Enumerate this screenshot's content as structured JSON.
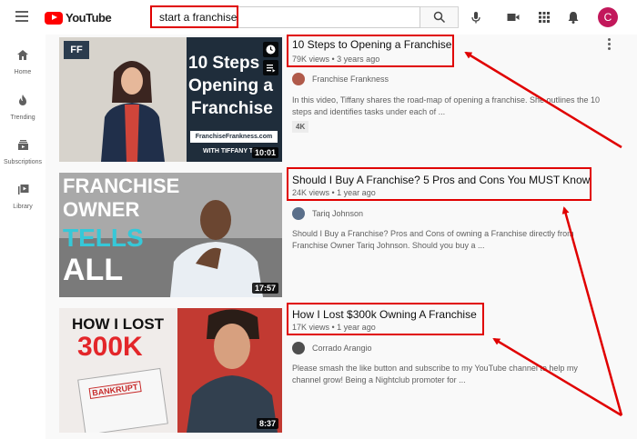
{
  "app": {
    "logo_text": "YouTube",
    "avatar_letter": "C"
  },
  "search": {
    "query": "start a franchise"
  },
  "sidebar": {
    "items": [
      {
        "label": "Home",
        "icon": "home-icon"
      },
      {
        "label": "Trending",
        "icon": "flame-icon"
      },
      {
        "label": "Subscriptions",
        "icon": "subscriptions-icon"
      },
      {
        "label": "Library",
        "icon": "library-icon"
      }
    ]
  },
  "videos": [
    {
      "title": "10 Steps to Opening a Franchise",
      "meta": "79K views • 3 years ago",
      "channel": "Franchise Frankness",
      "desc": "In this video, Tiffany shares the road-map of opening a franchise. She outlines the 10 steps and identifies tasks under each of ...",
      "badge": "4K",
      "duration": "10:01",
      "thumb": {
        "logo": "FF",
        "line1": "10 Steps",
        "line2": "Opening a",
        "line3": "Franchise",
        "url": "FranchiseFrankness.com",
        "byline": "WITH TIFFANY TO"
      }
    },
    {
      "title": "Should I Buy A Franchise? 5 Pros and Cons You MUST Know",
      "meta": "24K views • 1 year ago",
      "channel": "Tariq Johnson",
      "desc": "Should I Buy a Franchise? Pros and Cons of owning a Franchise directly from Franchise Owner Tariq Johnson. Should you buy a ...",
      "duration": "17:57",
      "thumb": {
        "line1": "FRANCHISE",
        "line2": "OWNER",
        "line3": "TELLS",
        "line4": "ALL"
      }
    },
    {
      "title": "How I Lost $300k Owning A Franchise",
      "meta": "17K views • 1 year ago",
      "channel": "Corrado Arangio",
      "desc": "Please smash the like button and subscribe to my YouTube channel to help my channel grow! Being a Nightclub promoter for ...",
      "duration": "8:37",
      "thumb": {
        "line1": "HOW I LOST",
        "line2": "300K",
        "stamp": "BANKRUPT"
      }
    }
  ],
  "colors": {
    "highlight": "#e00000",
    "youtube_red": "#ff0000"
  }
}
